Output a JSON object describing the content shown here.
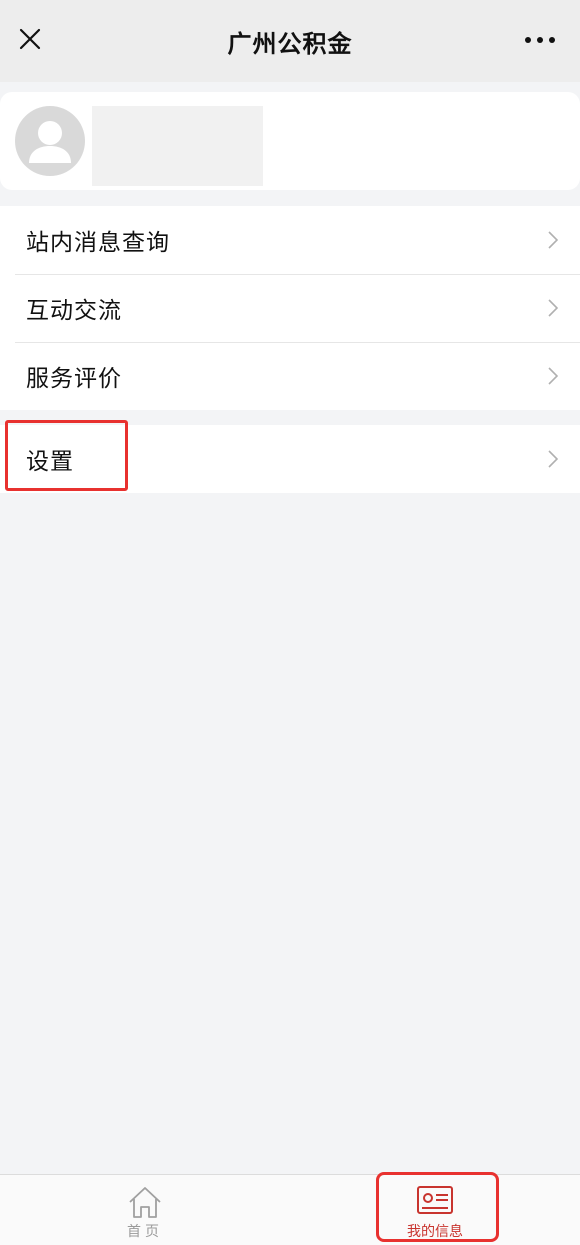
{
  "nav": {
    "title": "广州公积金",
    "close_icon": "close-icon",
    "more_icon": "more-icon"
  },
  "profile": {
    "avatar_icon": "user-avatar-icon"
  },
  "menu_group_1": [
    {
      "label": "站内消息查询",
      "icon": "chevron-right-icon"
    },
    {
      "label": "互动交流",
      "icon": "chevron-right-icon"
    },
    {
      "label": "服务评价",
      "icon": "chevron-right-icon"
    }
  ],
  "menu_group_2": [
    {
      "label": "设置",
      "icon": "chevron-right-icon"
    }
  ],
  "tabbar": {
    "tabs": [
      {
        "label": "首页",
        "icon": "home-icon",
        "active": false
      },
      {
        "label": "我的信息",
        "icon": "id-card-icon",
        "active": true
      }
    ]
  },
  "colors": {
    "highlight": "#e8312f",
    "active_tab": "#c8342e",
    "inactive_tab": "#9a9a9a",
    "background": "#f3f4f6",
    "navbar": "#ededed"
  }
}
